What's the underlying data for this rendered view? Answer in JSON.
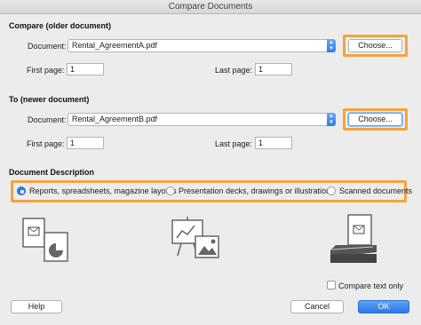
{
  "window": {
    "title": "Compare Documents"
  },
  "older": {
    "section_title": "Compare (older document)",
    "document_label": "Document:",
    "document_value": "Rental_AgreementA.pdf",
    "choose_label": "Choose...",
    "first_page_label": "First page:",
    "first_page_value": "1",
    "last_page_label": "Last page:",
    "last_page_value": "1"
  },
  "newer": {
    "section_title": "To (newer document)",
    "document_label": "Document:",
    "document_value": "Rental_AgreementB.pdf",
    "choose_label": "Choose...",
    "first_page_label": "First page:",
    "first_page_value": "1",
    "last_page_label": "Last page:",
    "last_page_value": "1"
  },
  "description": {
    "section_title": "Document Description",
    "options": [
      {
        "label": "Reports, spreadsheets, magazine layouts",
        "checked": true
      },
      {
        "label": "Presentation decks, drawings or illustrations",
        "checked": false
      },
      {
        "label": "Scanned documents",
        "checked": false
      }
    ]
  },
  "compare_text_only_label": "Compare text only",
  "footer": {
    "help_label": "Help",
    "cancel_label": "Cancel",
    "ok_label": "OK"
  },
  "colors": {
    "highlight": "#f4a43c",
    "accent": "#2f7de8"
  }
}
